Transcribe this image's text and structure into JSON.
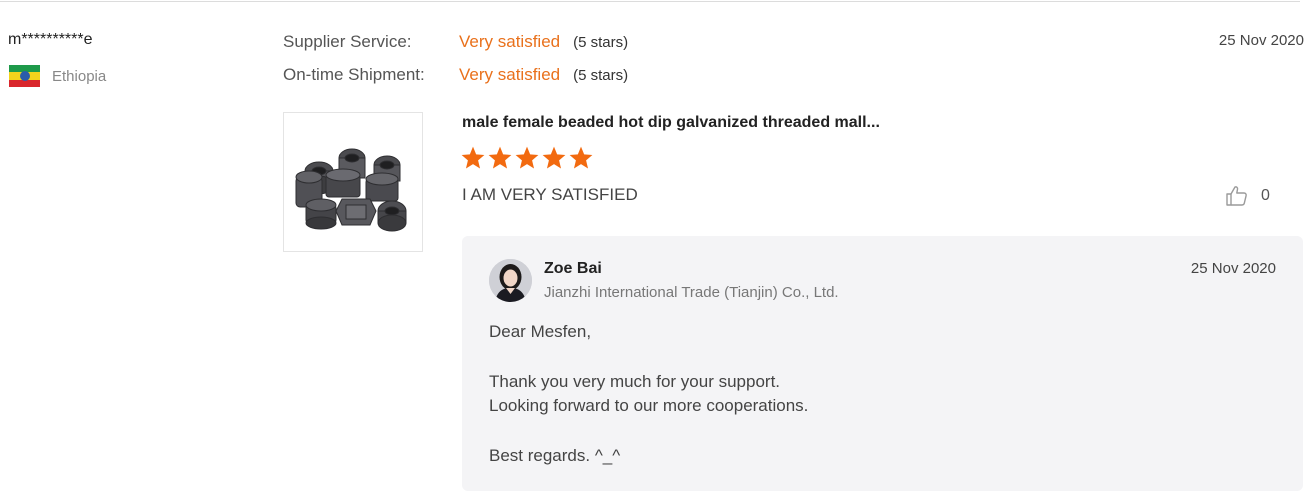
{
  "reviewer": {
    "name": "m**********e",
    "country": "Ethiopia",
    "flag_icon": "ethiopia-flag-icon"
  },
  "ratings": [
    {
      "label": "Supplier Service:",
      "value": "Very satisfied",
      "stars": "(5 stars)"
    },
    {
      "label": "On-time Shipment:",
      "value": "Very satisfied",
      "stars": "(5 stars)"
    }
  ],
  "review": {
    "date": "25 Nov 2020",
    "product_title": "male female beaded hot dip galvanized threaded mall...",
    "product_image_icon": "pipe-fittings-image",
    "star_rating": 5,
    "comment": "I AM VERY SATISFIED",
    "like_icon": "thumbs-up-icon",
    "like_count": "0"
  },
  "reply": {
    "name": "Zoe Bai",
    "company": "Jianzhi International Trade (Tianjin) Co., Ltd.",
    "date": "25 Nov 2020",
    "avatar_icon": "avatar",
    "lines": {
      "greeting": "Dear Mesfen,",
      "line1": "Thank you very much for your support.",
      "line2": "Looking forward to our more cooperations.",
      "closing": "Best regards. ^_^"
    }
  },
  "colors": {
    "accent": "#e9711c",
    "star": "#f26a10",
    "reply_bg": "#f4f4f6",
    "flag_green": "#1e9a4a",
    "flag_yellow": "#f3d31c",
    "flag_red": "#d9262c"
  }
}
